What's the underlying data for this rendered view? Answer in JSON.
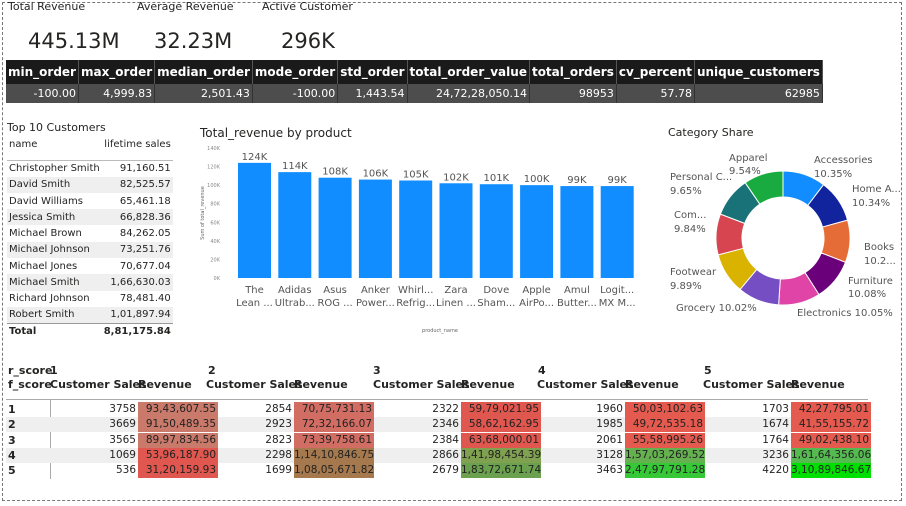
{
  "kpis": [
    {
      "label": "Total Revenue",
      "value": "445.13M"
    },
    {
      "label": "Average Revenue",
      "value": "32.23M"
    },
    {
      "label": "Active Customer",
      "value": "296K"
    }
  ],
  "stats": {
    "headers": [
      "min_order",
      "max_order",
      "median_order",
      "mode_order",
      "std_order",
      "total_order_value",
      "total_orders",
      "cv_percent",
      "unique_customers"
    ],
    "values": [
      "-100.00",
      "4,999.83",
      "2,501.43",
      "-100.00",
      "1,443.54",
      "24,72,28,050.14",
      "98953",
      "57.78",
      "62985"
    ]
  },
  "top10": {
    "title": "Top 10 Customers",
    "col_name": "name",
    "col_value": "lifetime sales",
    "rows": [
      {
        "name": "Christopher Smith",
        "value": "91,160.51"
      },
      {
        "name": "David Smith",
        "value": "82,525.57"
      },
      {
        "name": "David Williams",
        "value": "65,461.18"
      },
      {
        "name": "Jessica Smith",
        "value": "66,828.36"
      },
      {
        "name": "Michael Brown",
        "value": "84,262.05"
      },
      {
        "name": "Michael Johnson",
        "value": "73,251.76"
      },
      {
        "name": "Michael Jones",
        "value": "70,677.04"
      },
      {
        "name": "Michael Smith",
        "value": "1,66,630.03"
      },
      {
        "name": "Richard Johnson",
        "value": "78,481.40"
      },
      {
        "name": "Robert Smith",
        "value": "1,01,897.94"
      }
    ],
    "total_label": "Total",
    "total_value": "8,81,175.84"
  },
  "bar_chart": {
    "title": "Total_revenue by product",
    "ylabel": "Sum of total_revenue",
    "xlabel": "product_name",
    "color": "#118dff",
    "yticks": [
      "140K",
      "120K",
      "100K",
      "80K",
      "60K",
      "40K",
      "20K",
      "0K"
    ],
    "bars": [
      {
        "label1": "The",
        "label2": "Lean ...",
        "value_label": "124K"
      },
      {
        "label1": "Adidas",
        "label2": "Ultrab...",
        "value_label": "114K"
      },
      {
        "label1": "Asus",
        "label2": "ROG ...",
        "value_label": "108K"
      },
      {
        "label1": "Anker",
        "label2": "Power...",
        "value_label": "106K"
      },
      {
        "label1": "Whirl...",
        "label2": "Refrig...",
        "value_label": "105K"
      },
      {
        "label1": "Zara",
        "label2": "Linen ...",
        "value_label": "102K"
      },
      {
        "label1": "Dove",
        "label2": "Sham...",
        "value_label": "101K"
      },
      {
        "label1": "Apple",
        "label2": "AirPo...",
        "value_label": "100K"
      },
      {
        "label1": "Amul",
        "label2": "Butter...",
        "value_label": "99K"
      },
      {
        "label1": "Logit...",
        "label2": "MX M...",
        "value_label": "99K"
      }
    ]
  },
  "chart_data": {
    "type": "bar",
    "title": "Total_revenue by product",
    "xlabel": "product_name",
    "ylabel": "Sum of total_revenue",
    "ylim": [
      0,
      140000
    ],
    "categories": [
      "The Lean ...",
      "Adidas Ultrab...",
      "Asus ROG ...",
      "Anker Power...",
      "Whirl... Refrig...",
      "Zara Linen ...",
      "Dove Sham...",
      "Apple AirPo...",
      "Amul Butter...",
      "Logit... MX M..."
    ],
    "values": [
      124000,
      114000,
      108000,
      106000,
      105000,
      102000,
      101000,
      100000,
      99000,
      99000
    ]
  },
  "donut": {
    "title": "Category Share",
    "slices": [
      {
        "name": "Accessories",
        "pct": "10.35%",
        "value": 10.35,
        "color": "#118dff"
      },
      {
        "name": "Home A...",
        "pct": "10.34%",
        "value": 10.34,
        "color": "#12239e"
      },
      {
        "name": "Books",
        "pct": "10.2...",
        "value": 10.2,
        "color": "#e66c37"
      },
      {
        "name": "Furniture",
        "pct": "10.08%",
        "value": 10.08,
        "color": "#6b007b"
      },
      {
        "name": "Electronics",
        "pct": "10.05%",
        "value": 10.05,
        "color": "#e044a7"
      },
      {
        "name": "Grocery",
        "pct": "10.02%",
        "value": 10.02,
        "color": "#744ec2"
      },
      {
        "name": "Footwear",
        "pct": "9.89%",
        "value": 9.89,
        "color": "#d9b300"
      },
      {
        "name": "Com...",
        "pct": "9.84%",
        "value": 9.84,
        "color": "#d64550"
      },
      {
        "name": "Personal C...",
        "pct": "9.65%",
        "value": 9.65,
        "color": "#197278"
      },
      {
        "name": "Apparel",
        "pct": "9.54%",
        "value": 9.54,
        "color": "#1aab40"
      }
    ]
  },
  "matrix": {
    "row_header_1": "r_score",
    "row_header_2": "f_score",
    "groups": [
      "1",
      "2",
      "3",
      "4",
      "5"
    ],
    "col1": "Customer Sales",
    "col2": "Revenue",
    "rows": [
      {
        "f": "1",
        "cells": [
          [
            "3758",
            "93,43,607.55"
          ],
          [
            "2854",
            "70,75,731.13"
          ],
          [
            "2322",
            "59,79,021.95"
          ],
          [
            "1960",
            "50,03,102.63"
          ],
          [
            "1703",
            "42,27,795.01"
          ]
        ]
      },
      {
        "f": "2",
        "cells": [
          [
            "3669",
            "91,50,489.35"
          ],
          [
            "2923",
            "72,32,166.07"
          ],
          [
            "2346",
            "58,62,162.95"
          ],
          [
            "1985",
            "49,72,535.18"
          ],
          [
            "1674",
            "41,55,155.72"
          ]
        ]
      },
      {
        "f": "3",
        "cells": [
          [
            "3565",
            "89,97,834.56"
          ],
          [
            "2823",
            "73,39,758.61"
          ],
          [
            "2384",
            "63,68,000.01"
          ],
          [
            "2061",
            "55,58,995.26"
          ],
          [
            "1764",
            "49,02,438.10"
          ]
        ]
      },
      {
        "f": "4",
        "cells": [
          [
            "1069",
            "53,96,187.90"
          ],
          [
            "2298",
            "1,14,10,846.75"
          ],
          [
            "2866",
            "1,41,98,454.39"
          ],
          [
            "3128",
            "1,57,03,269.52"
          ],
          [
            "3236",
            "1,61,64,356.06"
          ]
        ]
      },
      {
        "f": "5",
        "cells": [
          [
            "536",
            "31,20,159.93"
          ],
          [
            "1699",
            "1,08,05,671.82"
          ],
          [
            "2679",
            "1,83,72,671.74"
          ],
          [
            "3463",
            "2,47,97,791.28"
          ],
          [
            "4220",
            "3,10,89,846.67"
          ]
        ]
      }
    ],
    "colors": [
      [
        "#c97a6b",
        "#d26d64",
        "#e0574f",
        "#e45a4f",
        "#e45a4f"
      ],
      [
        "#c97a6b",
        "#d26d64",
        "#e0574f",
        "#e45a4f",
        "#e45a4f"
      ],
      [
        "#c97a6b",
        "#d26d64",
        "#e0574f",
        "#e45a4f",
        "#e45a4f"
      ],
      [
        "#e0574f",
        "#a5794d",
        "#7fa150",
        "#65b150",
        "#55bb50"
      ],
      [
        "#e0574f",
        "#a5794d",
        "#6aa04e",
        "#36c837",
        "#00e000"
      ]
    ]
  }
}
